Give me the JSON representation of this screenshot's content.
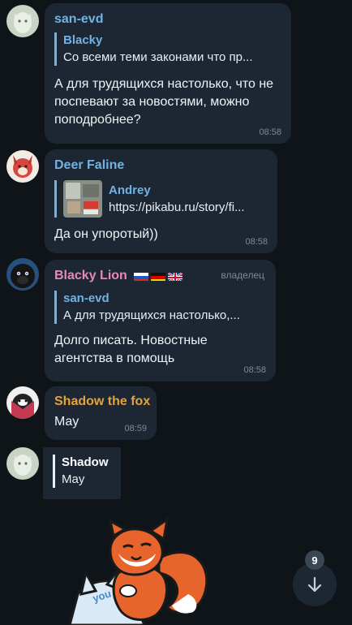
{
  "colors": {
    "background": "#0f1419",
    "bubble": "#1d2733",
    "accent": "#6fb3e6",
    "meta": "#7d8a98"
  },
  "messages": [
    {
      "sender": "san-evd",
      "sender_color": "#6fb3e6",
      "avatar": "avatar-san-evd",
      "reply": {
        "name": "Blacky",
        "text": "Со всеми теми законами что пр..."
      },
      "text": "А для трудящихся настолько, что не поспевают за новостями, можно поподробнее?",
      "time": "08:58"
    },
    {
      "sender": "Deer Faline",
      "sender_color": "#6fb3e6",
      "avatar": "avatar-deer-faline",
      "reply": {
        "name": "Andrey",
        "text": "https://pikabu.ru/story/fi..."
      },
      "text": "Да он упоротый))",
      "time": "08:58"
    },
    {
      "sender": "Blacky Lion",
      "sender_color": "#e58ab8",
      "badge": "владелец",
      "avatar": "avatar-blacky-lion",
      "reply": {
        "name": "san-evd",
        "text": "А для трудящихся настолько,..."
      },
      "text": "Долго писать. Новостные агентства в помощь",
      "time": "08:58"
    },
    {
      "sender": "Shadow the fox",
      "sender_color": "#e6a23c",
      "avatar": "avatar-shadow",
      "text": "May",
      "time": "08:59"
    },
    {
      "avatar": "avatar-san-evd",
      "reply": {
        "name": "Shadow",
        "text": "May"
      }
    }
  ],
  "scroll_button": {
    "icon": "arrow-down-icon",
    "badge": "9"
  },
  "sticker": {
    "icon": "fox-sticker",
    "lettering": "you"
  }
}
